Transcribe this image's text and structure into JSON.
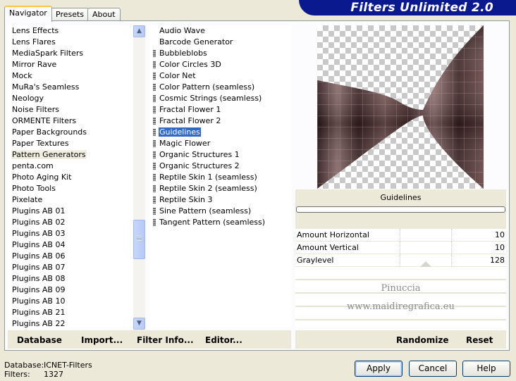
{
  "tabs": [
    "Navigator",
    "Presets",
    "About"
  ],
  "title": "Filters Unlimited 2.0",
  "categories": {
    "items": [
      "Lens Effects",
      "Lens Flares",
      "MediaSpark Filters",
      "Mirror Rave",
      "Mock",
      "MuRa's Seamless",
      "Neology",
      "Noise Filters",
      "ORMENTE Filters",
      "Paper Backgrounds",
      "Paper Textures",
      "Pattern Generators",
      "penta.com",
      "Photo Aging Kit",
      "Photo Tools",
      "Pixelate",
      "Plugins AB 01",
      "Plugins AB 02",
      "Plugins AB 03",
      "Plugins AB 04",
      "Plugins AB 06",
      "Plugins AB 07",
      "Plugins AB 08",
      "Plugins AB 09",
      "Plugins AB 10",
      "Plugins AB 21",
      "Plugins AB 22"
    ],
    "selected": "Pattern Generators"
  },
  "filters": {
    "items": [
      "Audio Wave",
      "Barcode Generator",
      "Bubbleblobs",
      "Color Circles 3D",
      "Color Net",
      "Color Pattern (seamless)",
      "Cosmic Strings (seamless)",
      "Fractal Flower 1",
      "Fractal Flower 2",
      "Guidelines",
      "Magic Flower",
      "Organic Structures 1",
      "Organic Structures 2",
      "Reptile Skin 1 (seamless)",
      "Reptile Skin 2 (seamless)",
      "Reptile Skin 3",
      "Sine Pattern (seamless)",
      "Tangent Pattern (seamless)"
    ],
    "bulleted_from": 2,
    "selected": "Guidelines"
  },
  "preview": {
    "filter_name": "Guidelines",
    "progress": 0
  },
  "parameters": [
    {
      "label": "Amount Horizontal",
      "value": "10",
      "level": 0.04
    },
    {
      "label": "Amount Vertical",
      "value": "10",
      "level": 0.04
    },
    {
      "label": "Graylevel",
      "value": "128",
      "level": 0.5
    }
  ],
  "watermark": {
    "line1": "Pinuccia",
    "line2": "www.maidiregrafica.eu"
  },
  "bottom_buttons": {
    "database": "Database",
    "import": "Import...",
    "filter_info": "Filter Info...",
    "editor": "Editor...",
    "randomize": "Randomize",
    "reset": "Reset"
  },
  "status": {
    "database_label": "Database:",
    "database_value": "ICNET-Filters",
    "filters_label": "Filters:",
    "filters_value": "1327"
  },
  "dialog_buttons": {
    "apply": "Apply",
    "cancel": "Cancel",
    "help": "Help"
  },
  "colors": {
    "selection": "#316ac5",
    "banner": "#0a1a8e",
    "tab_highlight": "#ffc83c",
    "swatch": "#6b4d4d"
  }
}
